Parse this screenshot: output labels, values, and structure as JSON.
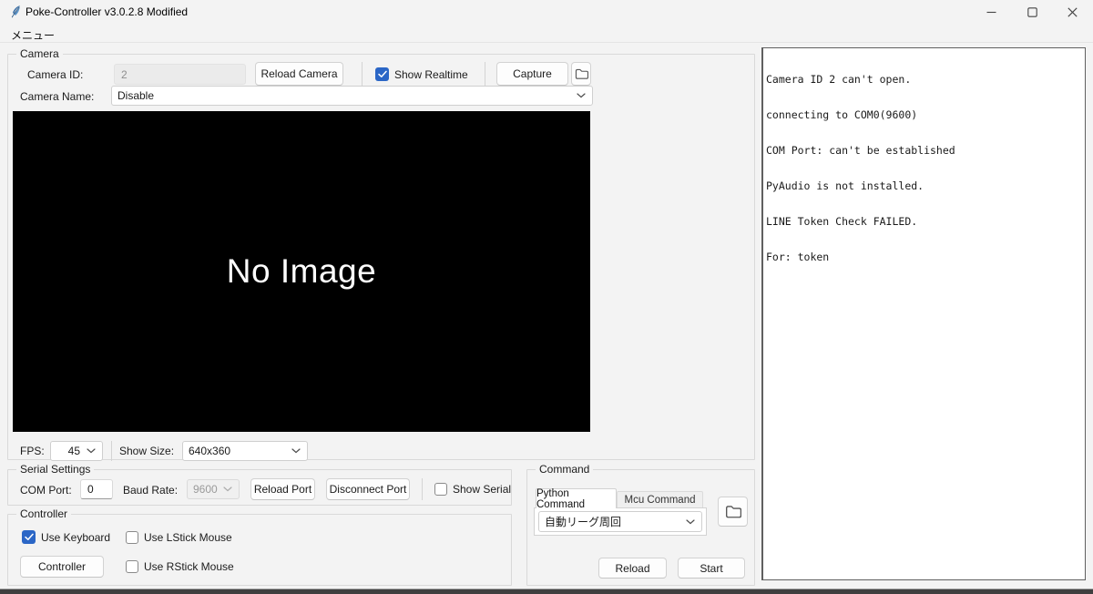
{
  "window": {
    "title": "Poke-Controller v3.0.2.8 Modified"
  },
  "menu": {
    "item": "メニュー"
  },
  "camera": {
    "group_label": "Camera",
    "camera_id_label": "Camera ID:",
    "camera_id_value": "2",
    "reload_camera_button": "Reload Camera",
    "show_realtime_label": "Show Realtime",
    "show_realtime_checked": true,
    "capture_button": "Capture",
    "camera_name_label": "Camera Name:",
    "camera_name_value": "Disable",
    "no_image_text": "No Image",
    "fps_label": "FPS:",
    "fps_value": "45",
    "show_size_label": "Show Size:",
    "show_size_value": "640x360"
  },
  "serial": {
    "group_label": "Serial Settings",
    "com_port_label": "COM Port:",
    "com_port_value": "0",
    "baud_rate_label": "Baud Rate:",
    "baud_rate_value": "9600",
    "reload_port_button": "Reload Port",
    "disconnect_port_button": "Disconnect Port",
    "show_serial_label": "Show Serial",
    "show_serial_checked": false
  },
  "controller": {
    "group_label": "Controller",
    "use_keyboard_label": "Use Keyboard",
    "use_keyboard_checked": true,
    "use_lstick_label": "Use LStick Mouse",
    "use_lstick_checked": false,
    "controller_button": "Controller",
    "use_rstick_label": "Use RStick Mouse",
    "use_rstick_checked": false
  },
  "command": {
    "group_label": "Command",
    "tabs": [
      {
        "label": "Python Command",
        "active": true
      },
      {
        "label": "Mcu Command",
        "active": false
      }
    ],
    "selected_command": "自動リーグ周回",
    "reload_button": "Reload",
    "start_button": "Start"
  },
  "log": {
    "lines": [
      "Camera ID 2 can't open.",
      "connecting to COM0(9600)",
      "COM Port: can't be established",
      "PyAudio is not installed.",
      "LINE Token Check FAILED.",
      "For: token"
    ]
  },
  "colors": {
    "accent": "#2b66c6",
    "window_bg": "#f3f3f3",
    "canvas_bg": "#000000"
  }
}
